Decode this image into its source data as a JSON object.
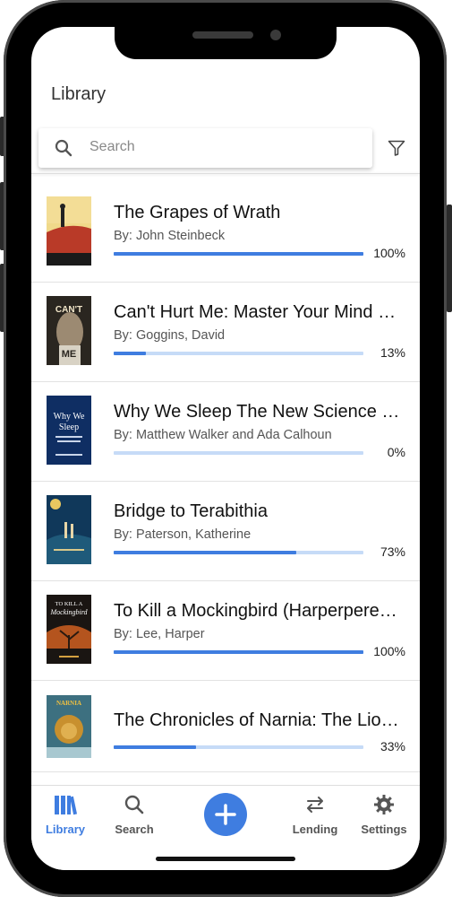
{
  "header": {
    "title": "Library"
  },
  "search": {
    "placeholder": "Search"
  },
  "colors": {
    "accent": "#3f7de0",
    "track": "#c6dbf7"
  },
  "books": [
    {
      "title": "The Grapes of Wrath",
      "author": "By: John Steinbeck",
      "progress_label": "100%",
      "progress": 1.0
    },
    {
      "title": "Can't Hurt Me: Master Your Mind and Defy the Odds",
      "author": "By: Goggins, David",
      "progress_label": "13%",
      "progress": 0.13
    },
    {
      "title": "Why We Sleep The New Science of Sleep and Dreams",
      "author": "By: Matthew Walker and Ada Calhoun",
      "progress_label": "0%",
      "progress": 0.0
    },
    {
      "title": "Bridge to Terabithia",
      "author": "By: Paterson, Katherine",
      "progress_label": "73%",
      "progress": 0.73
    },
    {
      "title": "To Kill a Mockingbird (Harperperennial Modern Classics)",
      "author": "By: Lee, Harper",
      "progress_label": "100%",
      "progress": 1.0
    },
    {
      "title": "The Chronicles of Narnia: The Lion, the Witch and the Wardrobe",
      "author": "",
      "progress_label": "33%",
      "progress": 0.33
    }
  ],
  "covers": [
    {
      "icon": "book-cover-grapes-of-wrath"
    },
    {
      "icon": "book-cover-cant-hurt-me",
      "text": "CAN'T HURT ME"
    },
    {
      "icon": "book-cover-why-we-sleep",
      "text": "Why We Sleep"
    },
    {
      "icon": "book-cover-bridge-to-terabithia"
    },
    {
      "icon": "book-cover-to-kill-a-mockingbird",
      "text": "TO KILL A Mockingbird"
    },
    {
      "icon": "book-cover-narnia",
      "text": "NARNIA"
    }
  ],
  "nav": {
    "library": "Library",
    "search": "Search",
    "add": "+",
    "lending": "Lending",
    "settings": "Settings"
  }
}
